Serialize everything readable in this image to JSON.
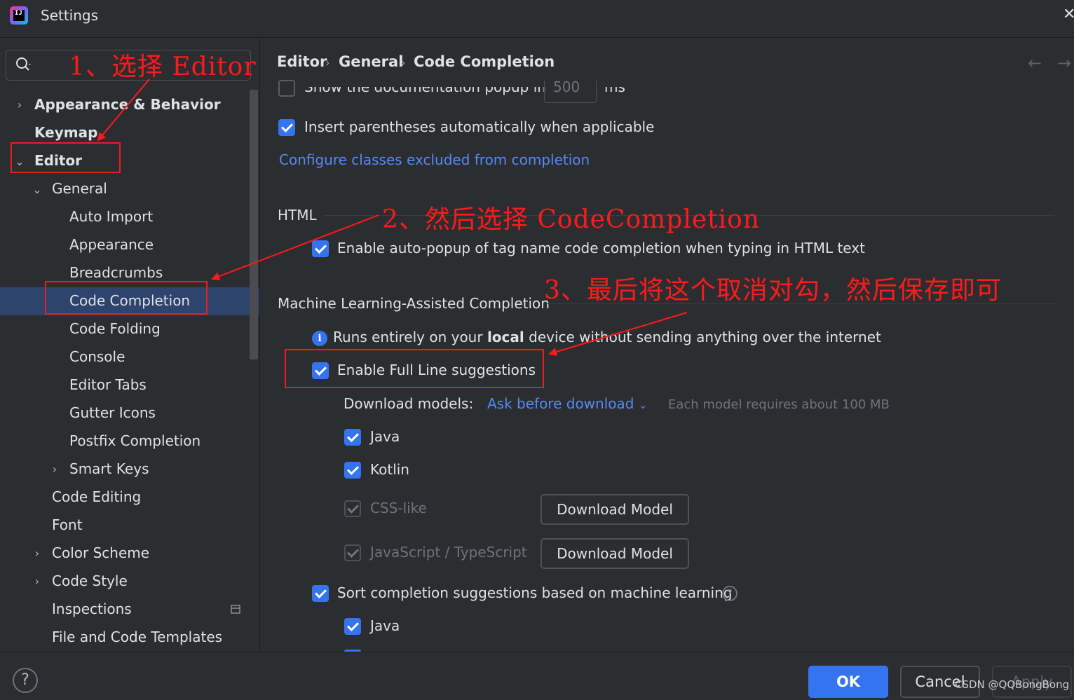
{
  "window": {
    "title": "Settings",
    "close_glyph": "✕"
  },
  "search": {
    "placeholder": ""
  },
  "sidebar": {
    "items": [
      {
        "label": "Appearance & Behavior"
      },
      {
        "label": "Keymap"
      },
      {
        "label": "Editor"
      },
      {
        "label": "General"
      },
      {
        "label": "Auto Import"
      },
      {
        "label": "Appearance"
      },
      {
        "label": "Breadcrumbs"
      },
      {
        "label": "Code Completion"
      },
      {
        "label": "Code Folding"
      },
      {
        "label": "Console"
      },
      {
        "label": "Editor Tabs"
      },
      {
        "label": "Gutter Icons"
      },
      {
        "label": "Postfix Completion"
      },
      {
        "label": "Smart Keys"
      },
      {
        "label": "Code Editing"
      },
      {
        "label": "Font"
      },
      {
        "label": "Color Scheme"
      },
      {
        "label": "Code Style"
      },
      {
        "label": "Inspections"
      },
      {
        "label": "File and Code Templates"
      }
    ]
  },
  "breadcrumb": {
    "items": [
      "Editor",
      "General",
      "Code Completion"
    ]
  },
  "content": {
    "doc_popup_label": "Show the documentation popup in",
    "doc_popup_value": "500",
    "doc_popup_unit": "ms",
    "insert_parens_label": "Insert parentheses automatically when applicable",
    "configure_link": "Configure classes excluded from completion",
    "html_section": "HTML",
    "html_autopopup_label": "Enable auto-popup of tag name code completion when typing in HTML text",
    "ml_section": "Machine Learning-Assisted Completion",
    "ml_info_prefix": "Runs entirely on your ",
    "ml_info_bold": "local",
    "ml_info_suffix": " device without sending anything over the internet",
    "full_line_label": "Enable Full Line suggestions",
    "download_models_label": "Download models:",
    "download_models_value": "Ask before download",
    "model_size_note": "Each model requires about 100 MB",
    "lang_java": "Java",
    "lang_kotlin": "Kotlin",
    "lang_css": "CSS-like",
    "lang_js": "JavaScript / TypeScript",
    "download_model_button": "Download Model",
    "sort_ml_label": "Sort completion suggestions based on machine learning",
    "sort_java": "Java"
  },
  "footer": {
    "ok": "OK",
    "cancel": "Cancel",
    "apply": "Apply",
    "help": "?"
  },
  "watermark": "CSDN @QQBongBong",
  "annotations": {
    "step1": "1、选择 Editor",
    "step2": "2、然后选择 CodeCompletion",
    "step3": "3、最后将这个取消对勾，然后保存即可"
  },
  "colors": {
    "accent": "#3574f0",
    "link": "#548af7",
    "annotation": "#ff1a1a",
    "selection": "#2e436e"
  }
}
